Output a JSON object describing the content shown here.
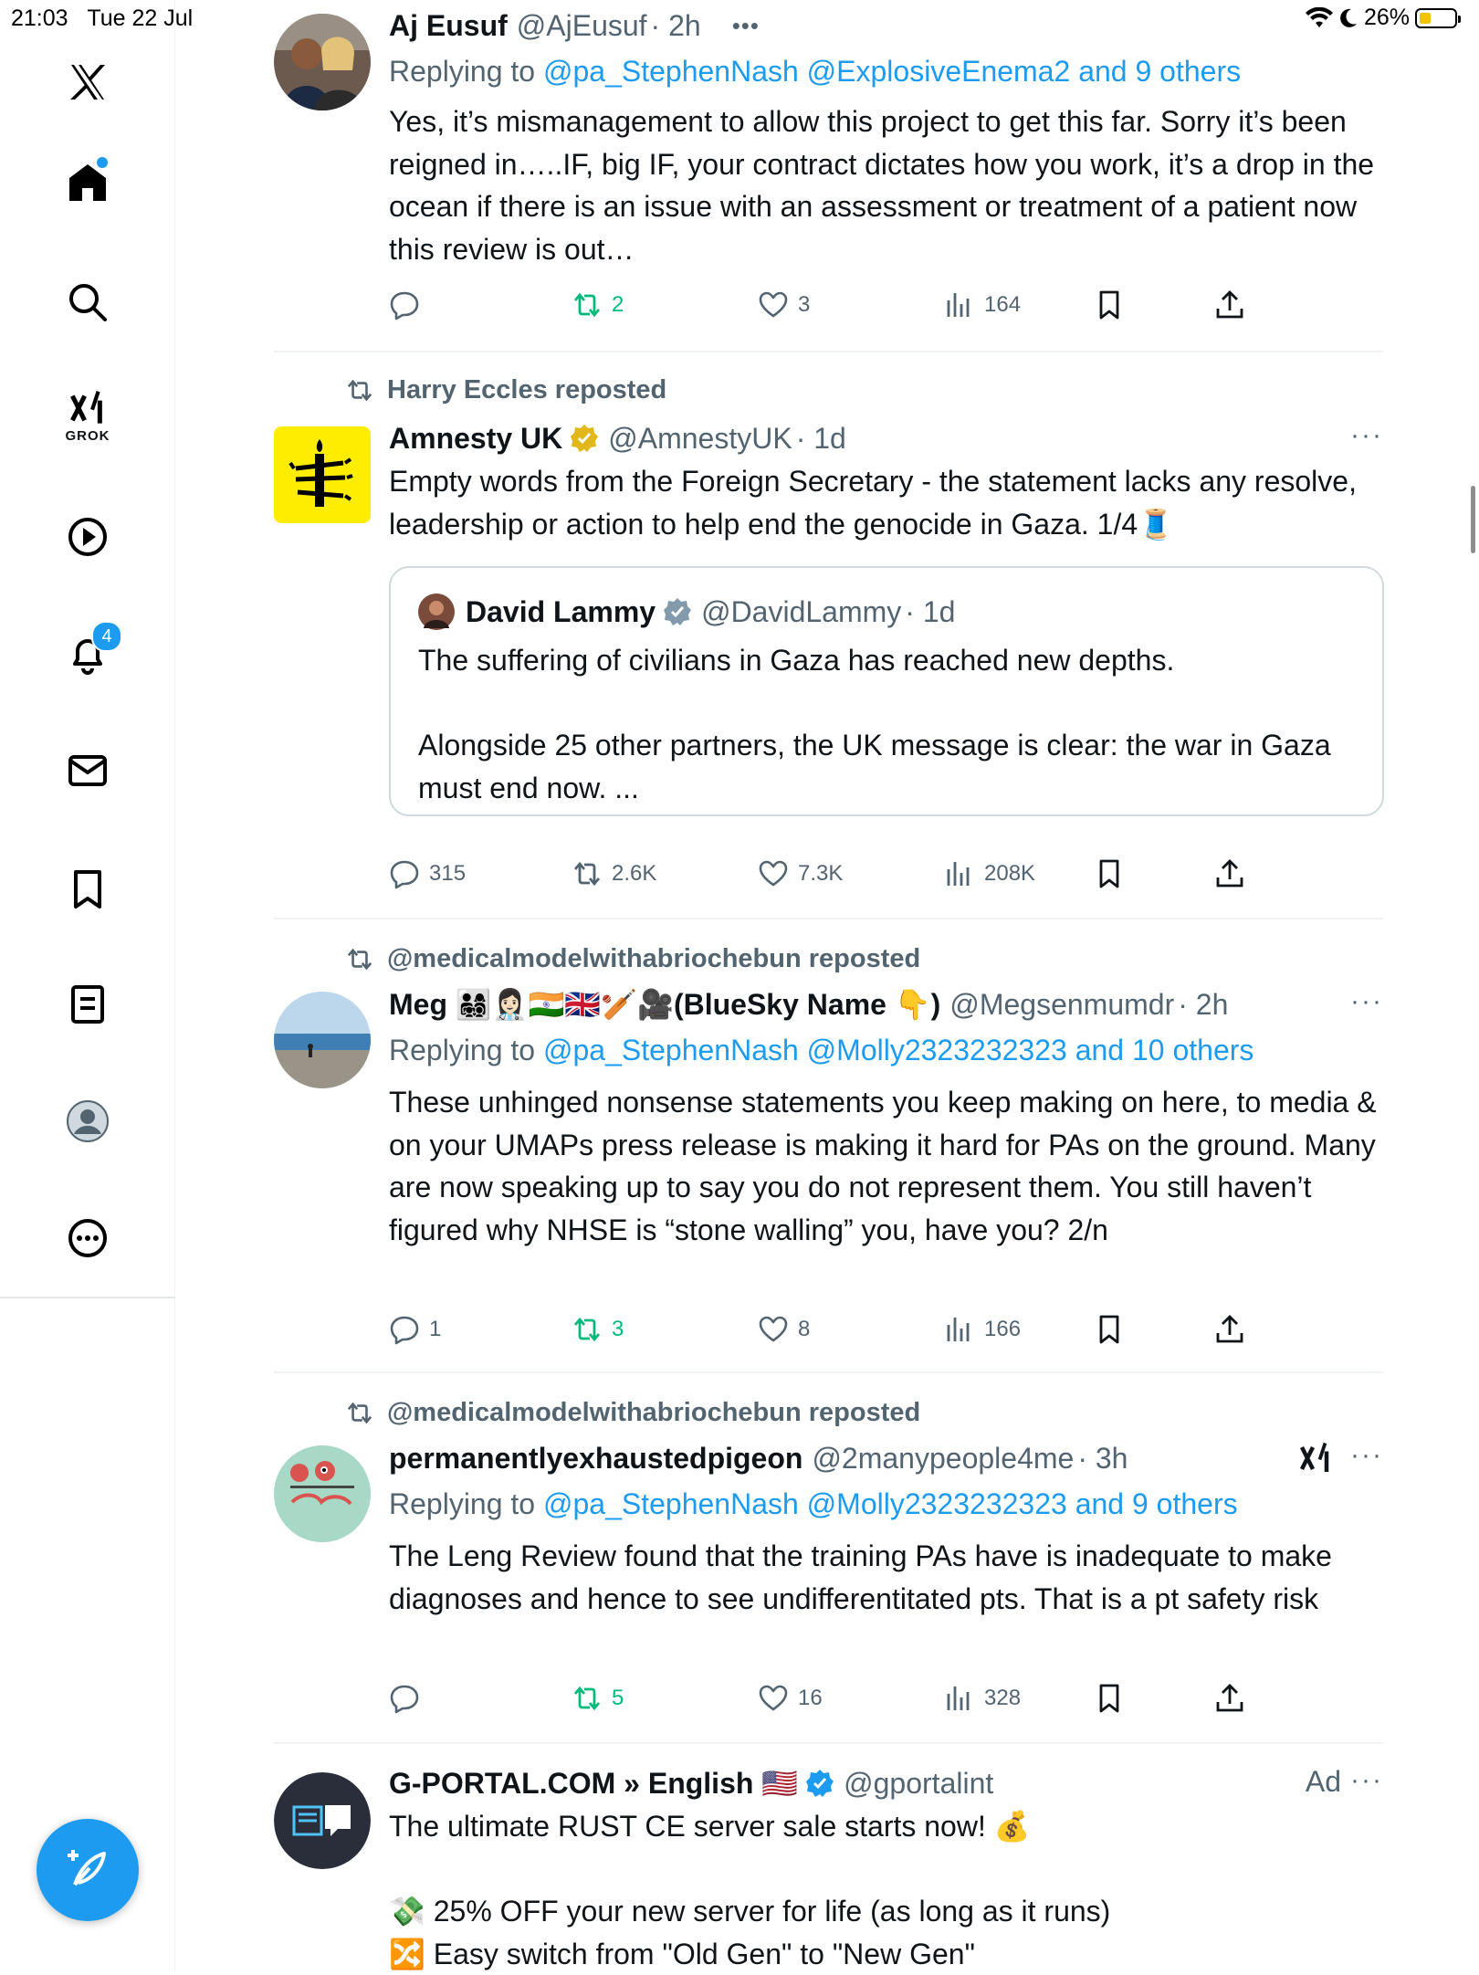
{
  "status_bar": {
    "time": "21:03",
    "date": "Tue 22 Jul",
    "battery": "26%"
  },
  "sidebar": {
    "grok_label": "GROK",
    "notification_count": "4"
  },
  "tweets": [
    {
      "name": "Aj Eusuf",
      "handle": "@AjEusuf",
      "time": "· 2h",
      "more": "•••",
      "reply_prefix": "Replying to ",
      "reply_to": "@pa_StephenNash @ExplosiveEnema2 and 9 others",
      "text": "Yes, it’s mismanagement to allow this project to get this far. Sorry it’s been reigned in…..IF, big IF, your contract dictates how you work, it’s a drop in the ocean if there is an issue with an assessment or treatment of a patient now this review is out…",
      "replies": "",
      "reposts": "2",
      "likes": "3",
      "views": "164"
    },
    {
      "reposted_by": "Harry Eccles reposted",
      "name": "Amnesty UK",
      "handle": "@AmnestyUK",
      "time": "· 1d",
      "more": "···",
      "text": "Empty words from the Foreign Secretary - the statement lacks any resolve, leadership or action to help end the genocide in Gaza. 1/4🧵",
      "quote": {
        "name": "David Lammy",
        "handle": "@DavidLammy",
        "time": "· 1d",
        "text": "The suffering of civilians in Gaza has reached new depths.\n\nAlongside 25 other partners, the UK message is clear: the war in Gaza must end now. ..."
      },
      "replies": "315",
      "reposts": "2.6K",
      "likes": "7.3K",
      "views": "208K"
    },
    {
      "reposted_by": "@medicalmodelwithabriochebun reposted",
      "name": "Meg 👨‍👩‍👧‍👦👩🏻‍⚕️🇮🇳🇬🇧🏏🎥(BlueSky Name 👇)",
      "handle": "@Megsenmumdr",
      "time": "· 2h",
      "more": "···",
      "reply_prefix": "Replying to ",
      "reply_to": "@pa_StephenNash @Molly2323232323 and 10 others",
      "text": "These unhinged nonsense statements you keep making on here, to media & on your UMAPs press release is making it hard for PAs on the ground. Many are now speaking up to say you do not represent them. You still haven’t figured why NHSE is “stone walling” you, have you? 2/n",
      "replies": "1",
      "reposts": "3",
      "likes": "8",
      "views": "166"
    },
    {
      "reposted_by": "@medicalmodelwithabriochebun reposted",
      "name": "permanentlyexhaustedpigeon",
      "handle": "@2manypeople4me",
      "time": "· 3h",
      "more": "···",
      "reply_prefix": "Replying to ",
      "reply_to": "@pa_StephenNash @Molly2323232323 and 9 others",
      "text": "The Leng Review found that the training PAs have is inadequate to make diagnoses and hence to see undifferentitated pts. That is a pt safety risk",
      "replies": "",
      "reposts": "5",
      "likes": "16",
      "views": "328"
    },
    {
      "name": "G-PORTAL.COM » English 🇺🇸",
      "handle": "@gportalint",
      "ad_label": "Ad",
      "more": "···",
      "text": "The ultimate RUST CE server sale starts now! 💰\n\n💸 25% OFF your new server for life (as long as it runs)\n🔀 Easy switch from \"Old Gen\" to \"New Gen\""
    }
  ],
  "colors": {
    "accent": "#1d9bf0",
    "repost_green": "#00ba7c",
    "muted": "#536471",
    "amnesty_yellow": "#ffed00"
  }
}
